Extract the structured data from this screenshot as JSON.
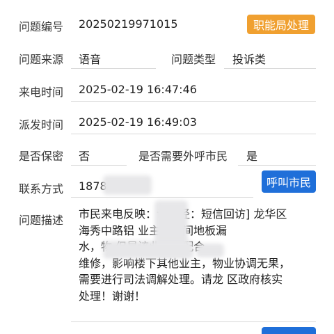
{
  "fields": {
    "issue_no_label": "问题编号",
    "issue_no_value": "20250219971015",
    "source_label": "问题来源",
    "source_value": "语音",
    "type_label": "问题类型",
    "type_value": "投诉类",
    "call_time_label": "来电时间",
    "call_time_value": "2025-02-19 16:47:46",
    "dispatch_time_label": "派发时间",
    "dispatch_time_value": "2025-02-19 16:49:03",
    "confidential_label": "是否保密",
    "confidential_value": "否",
    "callback_label": "是否需要外呼市民",
    "callback_value": "是",
    "contact_label": "联系方式",
    "contact_value": "1878",
    "description_label": "问题描述"
  },
  "buttons": {
    "dept_handle": "职能局处理",
    "call_citizen": "呼叫市民"
  },
  "description_lines": [
    "市民来电反映：访途径：短信回访] 龙华区",
    "海秀中路铝 业主卫生间地板漏",
    "水，物 但是该业主下配合",
    "维修，影响楼下其他业主，物业协调无果，",
    "需要进行司法调解处理。请龙 区政府核实",
    "处理！谢谢！"
  ],
  "colors": {
    "orange_button": "#f0a030",
    "blue_button": "#1f6fd9",
    "underline": "#d8d8d8"
  }
}
